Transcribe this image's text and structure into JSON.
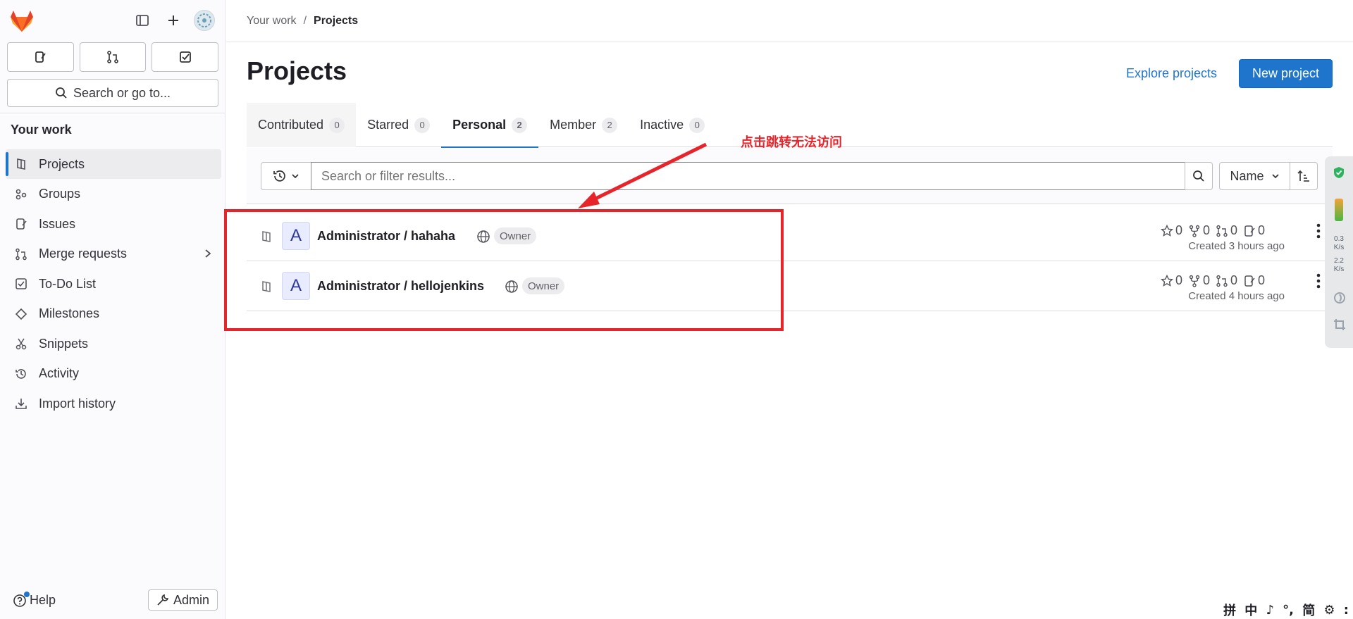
{
  "sidebar": {
    "search_label": "Search or go to...",
    "section_title": "Your work",
    "items": [
      {
        "label": "Projects",
        "icon": "project-icon"
      },
      {
        "label": "Groups",
        "icon": "group-icon"
      },
      {
        "label": "Issues",
        "icon": "issues-icon"
      },
      {
        "label": "Merge requests",
        "icon": "merge-request-icon"
      },
      {
        "label": "To-Do List",
        "icon": "todo-icon"
      },
      {
        "label": "Milestones",
        "icon": "milestone-icon"
      },
      {
        "label": "Snippets",
        "icon": "snippet-icon"
      },
      {
        "label": "Activity",
        "icon": "history-icon"
      },
      {
        "label": "Import history",
        "icon": "download-icon"
      }
    ],
    "help_label": "Help",
    "admin_label": "Admin"
  },
  "breadcrumb": {
    "root": "Your work",
    "current": "Projects"
  },
  "page": {
    "title": "Projects",
    "explore_label": "Explore projects",
    "new_project_label": "New project"
  },
  "tabs": [
    {
      "label": "Contributed",
      "count": "0"
    },
    {
      "label": "Starred",
      "count": "0"
    },
    {
      "label": "Personal",
      "count": "2"
    },
    {
      "label": "Member",
      "count": "2"
    },
    {
      "label": "Inactive",
      "count": "0"
    }
  ],
  "filter": {
    "placeholder": "Search or filter results...",
    "sort_label": "Name"
  },
  "projects": [
    {
      "avatar_letter": "A",
      "name": "Administrator / hahaha",
      "role": "Owner",
      "stars": "0",
      "forks": "0",
      "merge_requests": "0",
      "issues": "0",
      "created": "Created 3 hours ago"
    },
    {
      "avatar_letter": "A",
      "name": "Administrator / hellojenkins",
      "role": "Owner",
      "stars": "0",
      "forks": "0",
      "merge_requests": "0",
      "issues": "0",
      "created": "Created 4 hours ago"
    }
  ],
  "annotation": {
    "text": "点击跳转无法访问",
    "color": "#e8242b"
  },
  "widget": {
    "up_speed": "0.3",
    "down_speed": "2.2",
    "unit": "K/s"
  },
  "ime": {
    "items": [
      "拼",
      "中",
      "♪",
      "°,",
      "简",
      "⚙",
      ":"
    ]
  },
  "colors": {
    "accent": "#1f75cb",
    "annotation": "#e8242b"
  }
}
